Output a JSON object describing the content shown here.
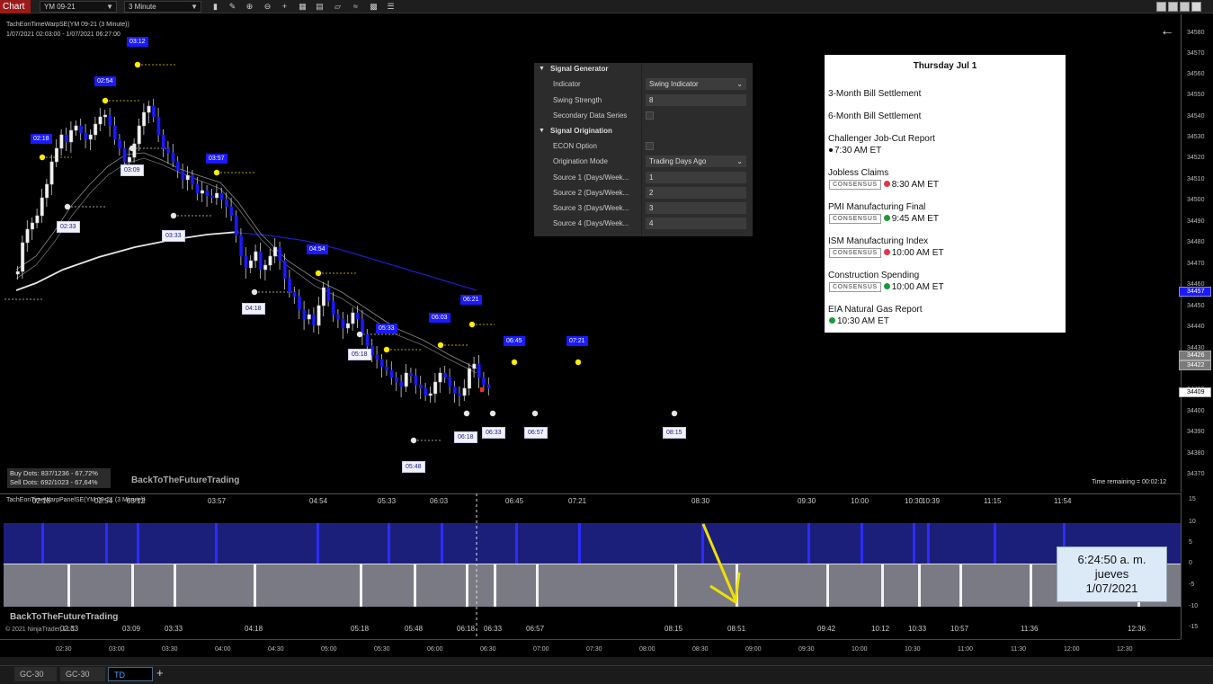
{
  "toolbar": {
    "chart_button": "Chart",
    "instrument": "YM 09-21",
    "interval": "3 Minute",
    "icons": [
      "bar-type-icon",
      "draw-icon",
      "zoom-in-icon",
      "zoom-out-icon",
      "crosshair-icon",
      "data-box-icon",
      "chart-trader-icon",
      "indicators-icon",
      "strategies-icon",
      "properties-icon"
    ],
    "window_buttons": [
      "minimize",
      "restore",
      "maximize",
      "close"
    ]
  },
  "price_panel": {
    "title": "TachEonTimeWarpSE(YM 09-21 (3 Minute))",
    "range": "1/07/2021 02:03:00 - 1/07/2021 06:27:00",
    "price_labels": [
      "34580",
      "34570",
      "34560",
      "34550",
      "34540",
      "34530",
      "34520",
      "34510",
      "34500",
      "34490",
      "34480",
      "34470",
      "34460",
      "34450",
      "34440",
      "34430",
      "34410",
      "34400",
      "34390",
      "34380",
      "34370"
    ],
    "price_tags": [
      {
        "text": "34457",
        "kind": "blue"
      },
      {
        "text": "34426",
        "kind": "gray"
      },
      {
        "text": "34422",
        "kind": "gray"
      },
      {
        "text": "34409",
        "kind": "white"
      }
    ],
    "signals_blue": [
      "03:12",
      "02:54",
      "02:18",
      "03:57",
      "04:54",
      "06:21",
      "06:03",
      "05:33",
      "06:45",
      "07:21"
    ],
    "signals_white": [
      "03:09",
      "02:33",
      "03:33",
      "04:18",
      "05:18",
      "06:18",
      "06:33",
      "06:57",
      "08:15",
      "05:48"
    ],
    "stats": {
      "buy": "Buy Dots: 837/1236 - 67,72%",
      "sell": "Sell Dots: 692/1023 - 67,64%"
    },
    "brand": "BackToTheFutureTrading",
    "time_remaining": "Time remaining = 00:02:12"
  },
  "properties": {
    "section1": "Signal Generator",
    "indicator_label": "Indicator",
    "indicator_value": "Swing Indicator",
    "swing_strength_label": "Swing Strength",
    "swing_strength_value": "8",
    "secondary_label": "Secondary Data Series",
    "section2": "Signal Origination",
    "econ_label": "ECON Option",
    "orig_mode_label": "Origination Mode",
    "orig_mode_value": "Trading Days Ago",
    "src1_label": "Source 1 (Days/Week...",
    "src1_value": "1",
    "src2_label": "Source 2 (Days/Week...",
    "src2_value": "2",
    "src3_label": "Source 3 (Days/Week...",
    "src3_value": "3",
    "src4_label": "Source 4 (Days/Week...",
    "src4_value": "4"
  },
  "calendar": {
    "header": "Thursday Jul 1",
    "badge": "CONSENSUS",
    "events": [
      {
        "name": "3-Month Bill Settlement"
      },
      {
        "name": "6-Month Bill Settlement"
      },
      {
        "name": "Challenger Job-Cut Report",
        "time": "7:30 AM ET",
        "dot": "#111111"
      },
      {
        "name": "Jobless Claims",
        "time": "8:30 AM ET",
        "dot": "#e0344f",
        "consensus": true
      },
      {
        "name": "PMI Manufacturing Final",
        "time": "9:45 AM ET",
        "dot": "#1a9a3a",
        "consensus": true
      },
      {
        "name": "ISM Manufacturing Index",
        "time": "10:00 AM ET",
        "dot": "#e0344f",
        "consensus": true
      },
      {
        "name": "Construction Spending",
        "time": "10:00 AM ET",
        "dot": "#1a9a3a",
        "consensus": true
      },
      {
        "name": "EIA Natural Gas Report",
        "time": "10:30 AM ET",
        "dot": "#1a9a3a"
      }
    ]
  },
  "lower_panel": {
    "title": "TachEonTimeWarpPanelSE(YM 09-21 (3 Minute))",
    "top_times": [
      "02:18",
      "02:54",
      "03:12",
      "03:57",
      "04:54",
      "05:33",
      "06:03",
      "06:45",
      "07:21",
      "08:30",
      "09:30",
      "10:00",
      "10:30",
      "10:39",
      "11:15",
      "11:54"
    ],
    "bottom_times": [
      "02:33",
      "03:09",
      "03:33",
      "04:18",
      "05:18",
      "05:48",
      "06:18",
      "06:33",
      "06:57",
      "08:15",
      "08:51",
      "09:42",
      "10:12",
      "10:33",
      "10:57",
      "11:36",
      "12:36"
    ],
    "brand": "BackToTheFutureTrading",
    "copyright": "© 2021 NinjaTrader, LLC",
    "osc_labels": [
      "15",
      "10",
      "5",
      "0",
      "-5",
      "-10",
      "-15"
    ],
    "clock": {
      "time": "6:24:50 a. m.",
      "day": "jueves",
      "date": "1/07/2021"
    }
  },
  "time_axis": [
    "02:30",
    "03:00",
    "03:30",
    "04:00",
    "04:30",
    "05:00",
    "05:30",
    "06:00",
    "06:30",
    "07:00",
    "07:30",
    "08:00",
    "08:30",
    "09:00",
    "09:30",
    "10:00",
    "10:30",
    "11:00",
    "11:30",
    "12:00",
    "12:30"
  ],
  "tabs": [
    "GC-30",
    "GC-30",
    "TD"
  ],
  "colors": {
    "blue_signal": "#1a1aff",
    "upper_band": "#1b1f7a",
    "lower_band": "#7a7a84",
    "dot_yellow": "#ffeb00",
    "ma_blue": "#1c1cc8"
  }
}
